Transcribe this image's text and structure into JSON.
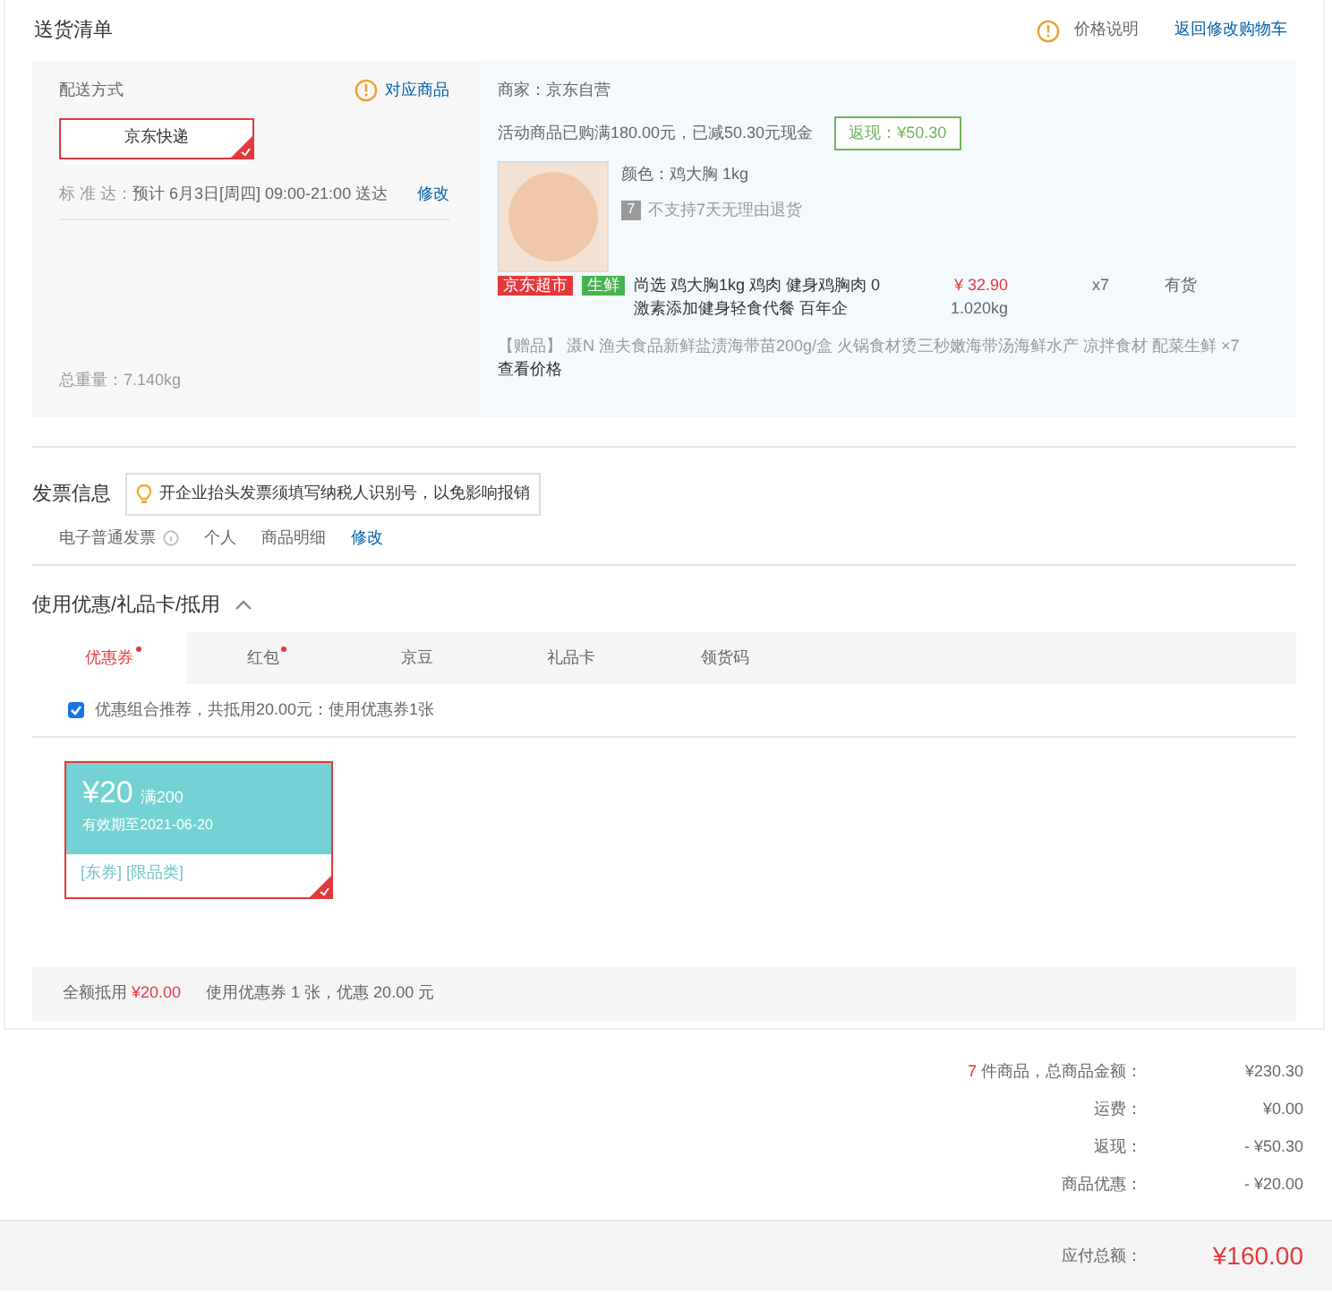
{
  "header": {
    "title": "送货清单",
    "price_note": "价格说明",
    "back_link": "返回修改购物车"
  },
  "shipping": {
    "label": "配送方式",
    "goods_link": "对应商品",
    "options": [
      {
        "label": "京东快递",
        "selected": true
      }
    ],
    "standard_label": "标 准 达：",
    "eta": "预计 6月3日[周四] 09:00-21:00 送达",
    "modify": "修改",
    "weight_label": "总重量：",
    "weight": "7.140kg"
  },
  "merchant": {
    "seller": "商家：京东自营",
    "promo": "活动商品已购满180.00元，已减50.30元现金",
    "cashback_badge": "返现：¥50.30",
    "item": {
      "spec": "颜色：鸡大胸 1kg",
      "return_icon": "7",
      "return_note": "不支持7天无理由退货",
      "tags": [
        {
          "label": "京东超市",
          "color": "#e4393c"
        },
        {
          "label": "生鲜",
          "color": "#47b34f"
        }
      ],
      "title": "尚选 鸡大胸1kg 鸡肉 健身鸡胸肉 0激素添加健身轻食代餐 百年企",
      "price": "¥ 32.90",
      "weight": "1.020kg",
      "qty": "x7",
      "stock": "有货"
    },
    "gift": "【赠品】 滠N 渔夫食品新鲜盐渍海带苗200g/盒 火锅食材烫三秒嫩海带汤海鲜水产 凉拌食材 配菜生鲜 ×7",
    "gift_link": "查看价格"
  },
  "invoice": {
    "title": "发票信息",
    "tip": "开企业抬头发票须填写纳税人识别号，以免影响报销",
    "type": "电子普通发票",
    "person": "个人",
    "content": "商品明细",
    "modify": "修改"
  },
  "discount": {
    "title": "使用优惠/礼品卡/抵用",
    "expanded": true,
    "tabs": [
      {
        "label": "优惠券",
        "selected": true,
        "dot": true
      },
      {
        "label": "红包",
        "selected": false,
        "dot": true
      },
      {
        "label": "京豆",
        "selected": false,
        "dot": false
      },
      {
        "label": "礼品卡",
        "selected": false,
        "dot": false
      },
      {
        "label": "领货码",
        "selected": false,
        "dot": false
      }
    ],
    "recommend": {
      "checked": true,
      "text": "优惠组合推荐，共抵用20.00元：使用优惠券1张"
    },
    "coupons": [
      {
        "amount": "¥20",
        "condition": "满200",
        "expiry": "有效期至2021-06-20",
        "tags": "[东券] [限品类]",
        "selected": true
      }
    ],
    "footer": {
      "label": "全额抵用",
      "amount": "¥20.00",
      "summary": "使用优惠券 1 张，优惠 20.00 元"
    }
  },
  "summary": {
    "rows": [
      {
        "count": "7",
        "label": "件商品，总商品金额：",
        "value": "¥230.30"
      },
      {
        "label": "运费：",
        "value": "¥0.00"
      },
      {
        "label": "返现：",
        "value": "- ¥50.30"
      },
      {
        "label": "商品优惠：",
        "value": "- ¥20.00"
      }
    ],
    "total_label": "应付总额：",
    "total": "¥160.00"
  }
}
